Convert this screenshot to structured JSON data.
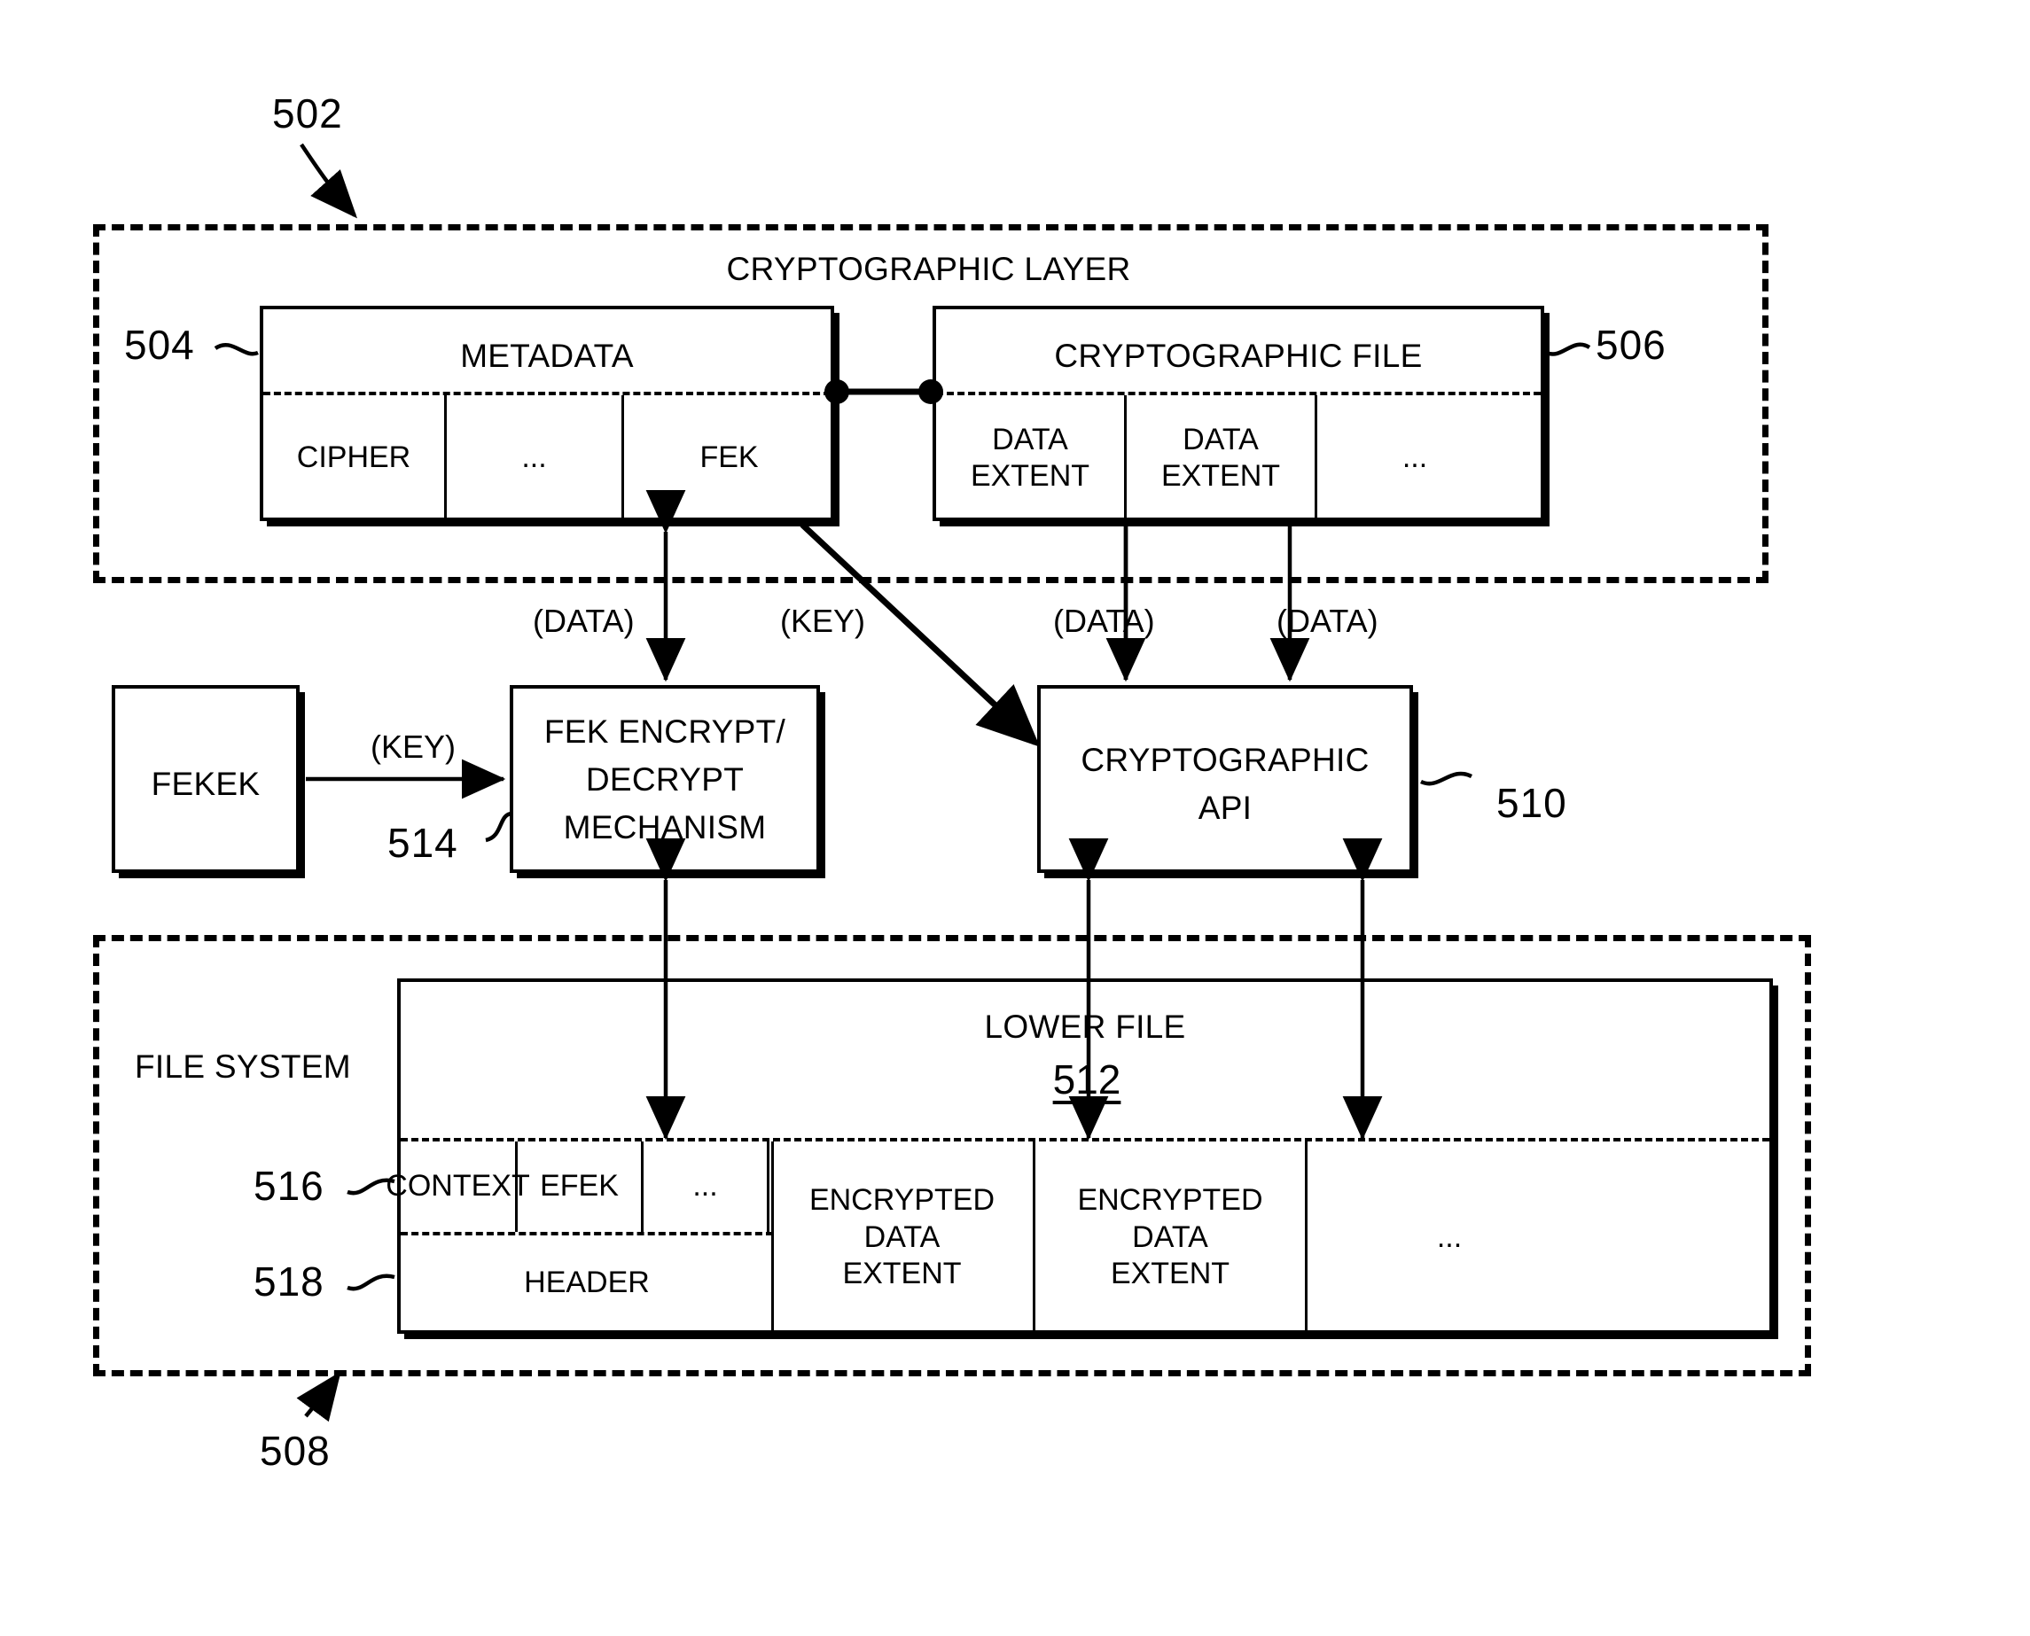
{
  "figure": {
    "crypto_layer": {
      "title": "CRYPTOGRAPHIC LAYER",
      "ref": "502",
      "metadata_box": {
        "ref": "504",
        "title": "METADATA",
        "cells": [
          "CIPHER",
          "...",
          "FEK"
        ]
      },
      "crypto_file_box": {
        "ref": "506",
        "title": "CRYPTOGRAPHIC FILE",
        "cells": [
          "DATA\nEXTENT",
          "DATA\nEXTENT",
          "..."
        ]
      }
    },
    "middle": {
      "fekek_box": {
        "title": "FEKEK"
      },
      "fek_mechanism_box": {
        "ref": "514",
        "line1": "FEK ENCRYPT/",
        "line2": "DECRYPT",
        "line3": "MECHANISM"
      },
      "crypto_api_box": {
        "ref": "510",
        "line1": "CRYPTOGRAPHIC",
        "line2": "API"
      },
      "edge_labels": {
        "fekek_to_mech": "(KEY)",
        "metadata_to_mech": "(DATA)",
        "metadata_to_api": "(KEY)",
        "extent1_to_api": "(DATA)",
        "extent2_to_api": "(DATA)"
      }
    },
    "file_system": {
      "title": "FILE SYSTEM",
      "ref": "508",
      "lower_file": {
        "title": "LOWER FILE",
        "ref": "512",
        "header_ref": "518",
        "header_label": "HEADER",
        "fields_ref": "516",
        "header_fields": [
          "CONTEXT",
          "EFEK",
          "..."
        ],
        "extents": [
          "ENCRYPTED\nDATA\nEXTENT",
          "ENCRYPTED\nDATA\nEXTENT",
          "..."
        ]
      }
    }
  }
}
